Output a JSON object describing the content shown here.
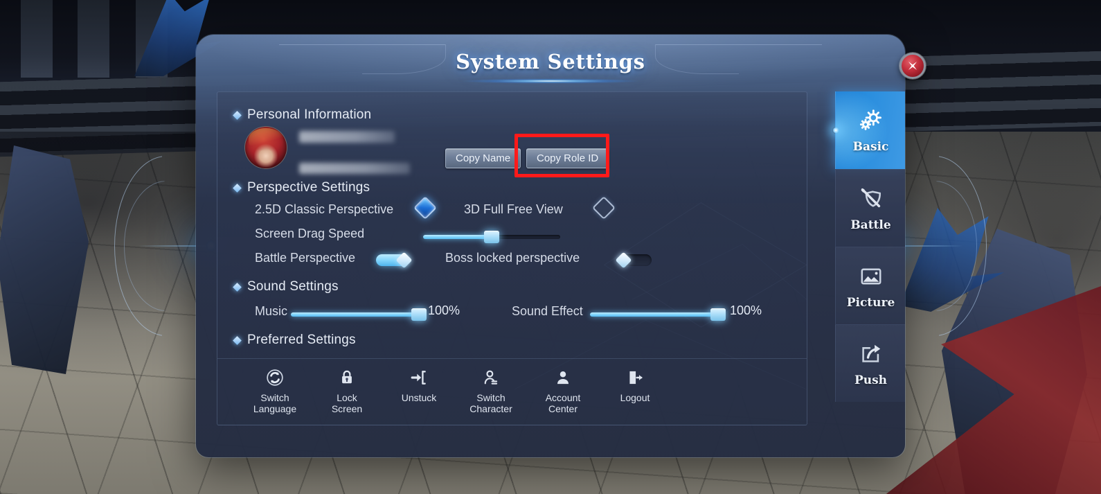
{
  "window": {
    "title": "System Settings",
    "close_label": "close"
  },
  "sections": {
    "personal": {
      "heading": "Personal Information",
      "name_redacted": true,
      "id_redacted": true,
      "copy_name_label": "Copy Name",
      "copy_role_id_label": "Copy Role ID"
    },
    "perspective": {
      "heading": "Perspective Settings",
      "option_25d": "2.5D Classic Perspective",
      "option_25d_selected": true,
      "option_3d": "3D Full Free View",
      "option_3d_selected": false,
      "drag_speed_label": "Screen Drag Speed",
      "drag_speed_value": 50,
      "battle_perspective_label": "Battle Perspective",
      "battle_perspective_on": true,
      "boss_locked_label": "Boss locked perspective",
      "boss_locked_on": false
    },
    "sound": {
      "heading": "Sound Settings",
      "music_label": "Music",
      "music_value": 100,
      "music_display": "100%",
      "effect_label": "Sound Effect",
      "effect_value": 100,
      "effect_display": "100%"
    },
    "preferred": {
      "heading": "Preferred Settings"
    }
  },
  "actions": [
    {
      "label": "Switch\nLanguage",
      "icon": "switch-language-icon"
    },
    {
      "label": "Lock\nScreen",
      "icon": "lock-screen-icon"
    },
    {
      "label": "Unstuck",
      "icon": "unstuck-icon"
    },
    {
      "label": "Switch\nCharacter",
      "icon": "switch-character-icon"
    },
    {
      "label": "Account\nCenter",
      "icon": "account-center-icon"
    },
    {
      "label": "Logout",
      "icon": "logout-icon"
    }
  ],
  "tabs": [
    {
      "label": "Basic",
      "icon": "gears-icon",
      "active": true
    },
    {
      "label": "Battle",
      "icon": "sword-shield-icon",
      "active": false
    },
    {
      "label": "Picture",
      "icon": "image-icon",
      "active": false
    },
    {
      "label": "Push",
      "icon": "share-arrow-icon",
      "active": false
    }
  ],
  "annotation": {
    "target": "Copy Role ID",
    "color": "#ff1a1a"
  },
  "colors": {
    "accent_cyan": "#7ed3fb",
    "tab_active_blue": "#2a8ede",
    "panel_dark": "#28304a",
    "close_red": "#c32f3c",
    "annotation_red": "#ff1a1a"
  }
}
